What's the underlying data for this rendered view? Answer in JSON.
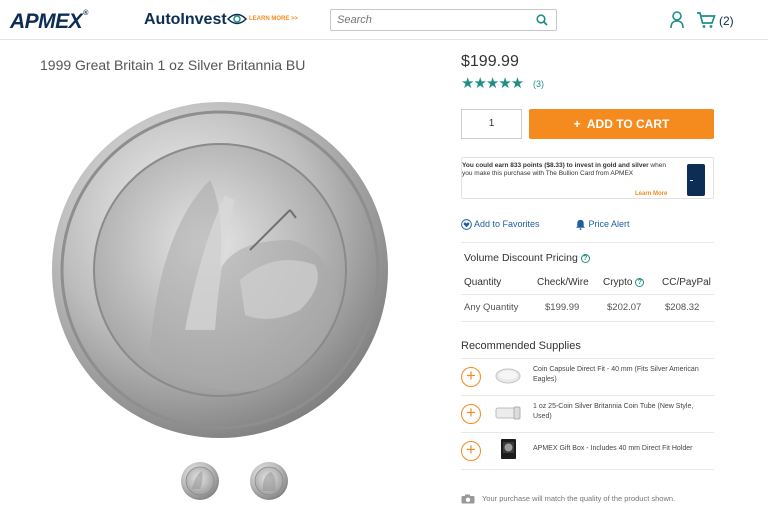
{
  "header": {
    "logo": "APMEX",
    "logo_mark": "®",
    "autoinvest": "AutoInvest",
    "learn_more": "LEARN MORE >>",
    "search_placeholder": "Search",
    "cart_count": "(2)"
  },
  "product": {
    "title": "1999 Great Britain 1 oz Silver Britannia BU",
    "price": "$199.99",
    "stars": "★★★★★",
    "review_count": "(3)",
    "quantity": "1",
    "add_to_cart": "ADD TO CART"
  },
  "promo": {
    "bold_text": "You could earn 833 points ($8.33) to invest in gold and silver",
    "text": " when you make this purchase with The Bullion Card from APMEX",
    "learn_more": "Learn More"
  },
  "actions": {
    "favorites": "Add to Favorites",
    "price_alert": "Price Alert"
  },
  "pricing": {
    "title": "Volume Discount Pricing",
    "headers": [
      "Quantity",
      "Check/Wire",
      "Crypto",
      "CC/PayPal"
    ],
    "rows": [
      [
        "Any Quantity",
        "$199.99",
        "$202.07",
        "$208.32"
      ]
    ]
  },
  "supplies": {
    "title": "Recommended Supplies",
    "items": [
      {
        "label": "Coin Capsule Direct Fit - 40 mm (Fits Silver American Eagles)"
      },
      {
        "label": "1 oz 25-Coin Silver Britannia Coin Tube (New Style, Used)"
      },
      {
        "label": "APMEX Gift Box - Includes 40 mm Direct Fit Holder"
      }
    ]
  },
  "footnote": "Your purchase will match the quality of the product shown.",
  "colors": {
    "brand_navy": "#0c2d54",
    "accent_orange": "#f58a1f",
    "teal": "#1f8f86"
  }
}
